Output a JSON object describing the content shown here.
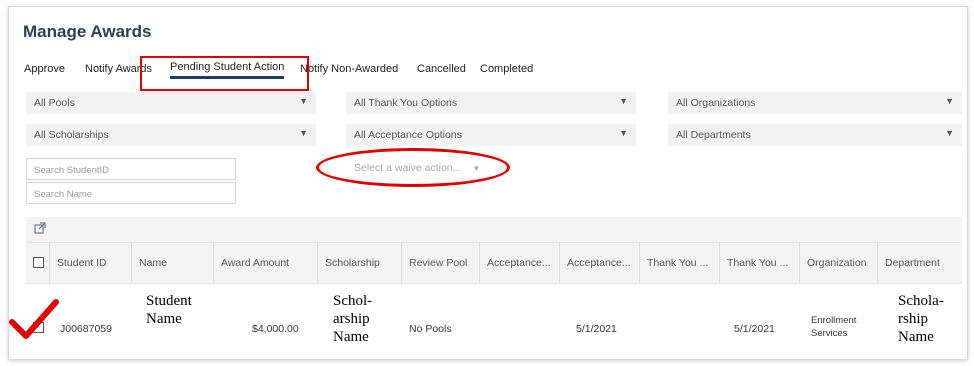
{
  "page": {
    "title": "Manage Awards"
  },
  "tabs": [
    {
      "label": "Approve",
      "active": false
    },
    {
      "label": "Notify Awards",
      "active": false
    },
    {
      "label": "Pending Student Action",
      "active": true
    },
    {
      "label": "Notify Non-Awarded",
      "active": false
    },
    {
      "label": "Cancelled",
      "active": false
    },
    {
      "label": "Completed",
      "active": false
    }
  ],
  "filters": {
    "pools": "All Pools",
    "thank_you": "All Thank You Options",
    "organizations": "All Organizations",
    "scholarships": "All Scholarships",
    "acceptance": "All Acceptance Options",
    "departments": "All Departments",
    "waive_placeholder": "Select a waive action..."
  },
  "search": {
    "student_id_placeholder": "Search StudentID",
    "name_placeholder": "Search Name"
  },
  "icons": {
    "export": "external-link-icon",
    "dropdown": "caret-down-icon",
    "annotation_check": "check-mark-icon"
  },
  "table": {
    "headers": [
      "Student ID",
      "Name",
      "Award Amount",
      "Scholarship",
      "Review Pool",
      "Acceptance...",
      "Acceptance...",
      "Thank You ...",
      "Thank You ...",
      "Organization",
      "Department"
    ],
    "row": {
      "student_id": "J00687059",
      "name_line1": "Student",
      "name_line2": "Name",
      "award_amount": "$4,000.00",
      "scholarship_line1": "Schol-",
      "scholarship_line2": "arship",
      "scholarship_line3": "Name",
      "review_pool": "No Pools",
      "acceptance_date": "5/1/2021",
      "thank_you_date": "5/1/2021",
      "organization_line1": "Enrollment",
      "organization_line2": "Services",
      "department_line1": "Schola-",
      "department_line2": "rship",
      "department_line3": "Name"
    }
  },
  "colors": {
    "annotation": "#e00000",
    "active_tab_underline": "#1f3a64",
    "filter_bg": "#f2f2f2"
  }
}
